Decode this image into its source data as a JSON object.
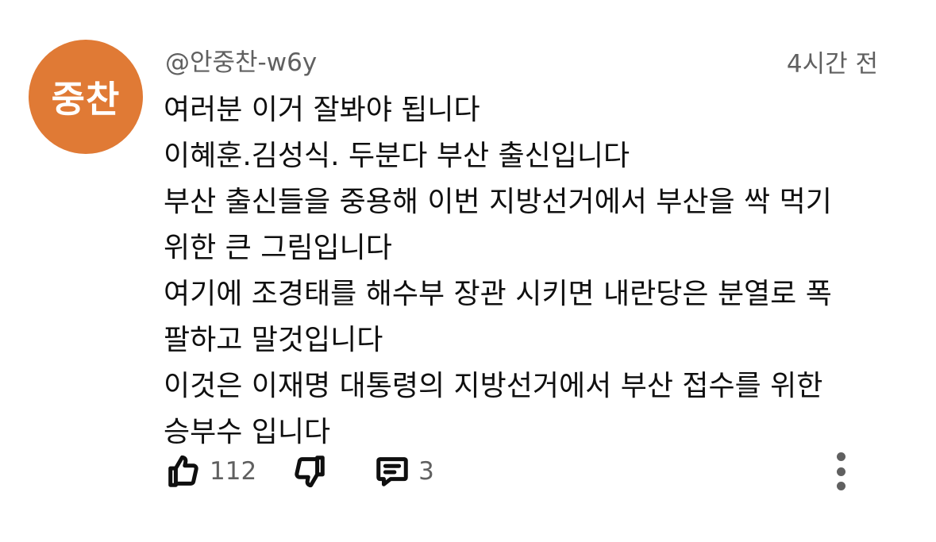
{
  "comment": {
    "avatar": {
      "text": "중찬",
      "color": "#e07a35"
    },
    "author_handle": "@안중찬-w6y",
    "timestamp": "4시간 전",
    "lines": [
      "여러분 이거 잘봐야 됩니다",
      "이혜훈.김성식. 두분다 부산 출신입니다",
      "부산 출신들을 중용해 이번 지방선거에서 부산을 싹 먹기",
      "위한 큰 그림입니다",
      "여기에 조경태를 해수부 장관 시키면 내란당은 분열로 폭",
      "팔하고 말것입니다",
      "이것은 이재명 대통령의 지방선거에서 부산 접수를 위한",
      "승부수 입니다"
    ],
    "actions": {
      "like_icon": "thumbs-up-icon",
      "like_count": "112",
      "dislike_icon": "thumbs-down-icon",
      "reply_icon": "comment-icon",
      "reply_count": "3",
      "more_icon": "more-vertical-icon"
    }
  }
}
